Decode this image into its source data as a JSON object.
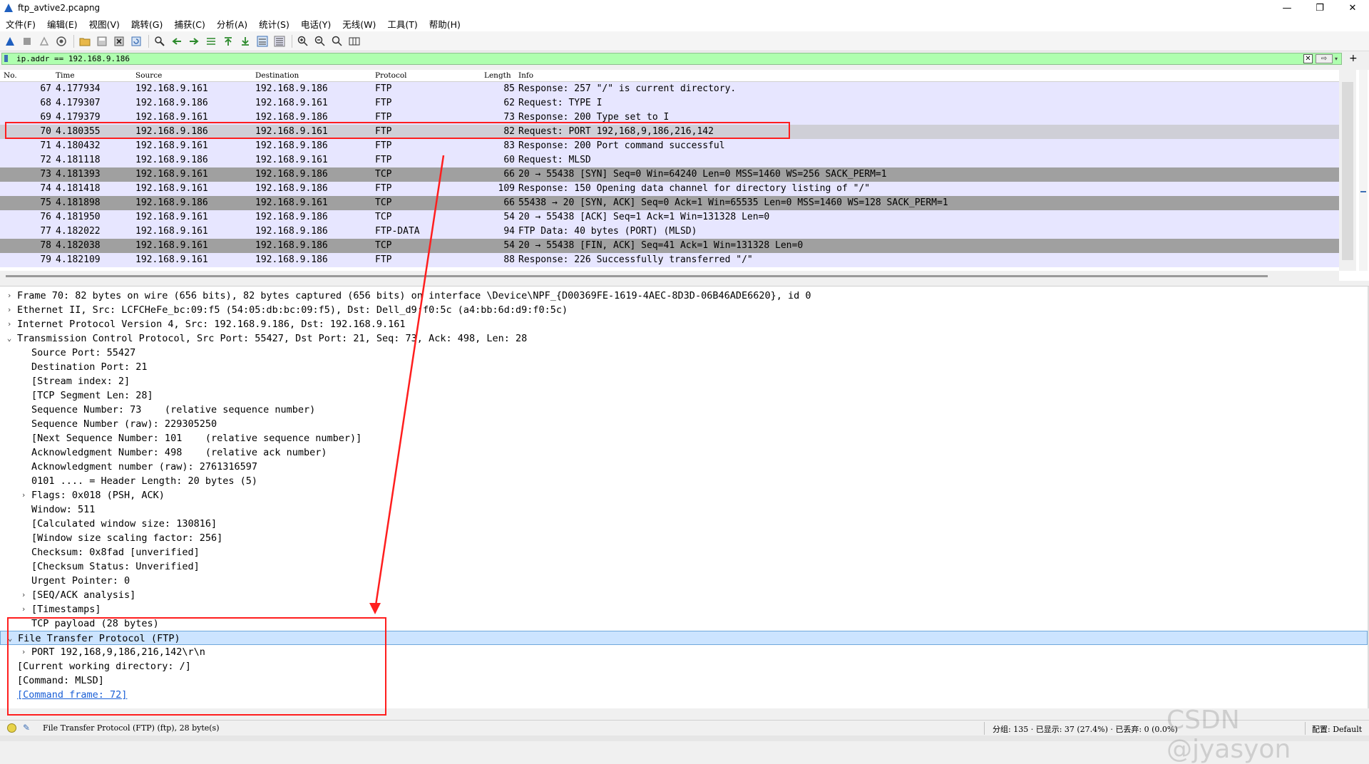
{
  "window": {
    "title": "ftp_avtive2.pcapng",
    "minimize": "—",
    "maximize": "❐",
    "close": "✕"
  },
  "menu": [
    "文件(F)",
    "编辑(E)",
    "视图(V)",
    "跳转(G)",
    "捕获(C)",
    "分析(A)",
    "统计(S)",
    "电话(Y)",
    "无线(W)",
    "工具(T)",
    "帮助(H)"
  ],
  "filter": {
    "value": "ip.addr == 192.168.9.186",
    "apply_icon": "⇨",
    "add_icon": "+"
  },
  "columns": {
    "no": "No.",
    "time": "Time",
    "source": "Source",
    "destination": "Destination",
    "protocol": "Protocol",
    "length": "Length",
    "info": "Info"
  },
  "colors": {
    "ftp_row": "#e7e6ff",
    "tcp_handshake_row": "#a0a0a0",
    "selected_row": "#cfcfd7",
    "filter_bg": "#afffaf",
    "annotation": "#ff1e1e",
    "link": "#1a5fd6"
  },
  "packets": [
    {
      "no": "67",
      "time": "4.177934",
      "src": "192.168.9.161",
      "dst": "192.168.9.186",
      "proto": "FTP",
      "len": "85",
      "info": "Response: 257 \"/\" is current directory.",
      "style": "ftp"
    },
    {
      "no": "68",
      "time": "4.179307",
      "src": "192.168.9.186",
      "dst": "192.168.9.161",
      "proto": "FTP",
      "len": "62",
      "info": "Request: TYPE I",
      "style": "ftp"
    },
    {
      "no": "69",
      "time": "4.179379",
      "src": "192.168.9.161",
      "dst": "192.168.9.186",
      "proto": "FTP",
      "len": "73",
      "info": "Response: 200 Type set to I",
      "style": "ftp"
    },
    {
      "no": "70",
      "time": "4.180355",
      "src": "192.168.9.186",
      "dst": "192.168.9.161",
      "proto": "FTP",
      "len": "82",
      "info": "Request: PORT 192,168,9,186,216,142",
      "style": "selected"
    },
    {
      "no": "71",
      "time": "4.180432",
      "src": "192.168.9.161",
      "dst": "192.168.9.186",
      "proto": "FTP",
      "len": "83",
      "info": "Response: 200 Port command successful",
      "style": "ftp"
    },
    {
      "no": "72",
      "time": "4.181118",
      "src": "192.168.9.186",
      "dst": "192.168.9.161",
      "proto": "FTP",
      "len": "60",
      "info": "Request: MLSD",
      "style": "ftp"
    },
    {
      "no": "73",
      "time": "4.181393",
      "src": "192.168.9.161",
      "dst": "192.168.9.186",
      "proto": "TCP",
      "len": "66",
      "info": "20 → 55438 [SYN] Seq=0 Win=64240 Len=0 MSS=1460 WS=256 SACK_PERM=1",
      "style": "tcp"
    },
    {
      "no": "74",
      "time": "4.181418",
      "src": "192.168.9.161",
      "dst": "192.168.9.186",
      "proto": "FTP",
      "len": "109",
      "info": "Response: 150 Opening data channel for directory listing of \"/\"",
      "style": "ftp"
    },
    {
      "no": "75",
      "time": "4.181898",
      "src": "192.168.9.186",
      "dst": "192.168.9.161",
      "proto": "TCP",
      "len": "66",
      "info": "55438 → 20 [SYN, ACK] Seq=0 Ack=1 Win=65535 Len=0 MSS=1460 WS=128 SACK_PERM=1",
      "style": "tcp"
    },
    {
      "no": "76",
      "time": "4.181950",
      "src": "192.168.9.161",
      "dst": "192.168.9.186",
      "proto": "TCP",
      "len": "54",
      "info": "20 → 55438 [ACK] Seq=1 Ack=1 Win=131328 Len=0",
      "style": "ftp"
    },
    {
      "no": "77",
      "time": "4.182022",
      "src": "192.168.9.161",
      "dst": "192.168.9.186",
      "proto": "FTP-DATA",
      "len": "94",
      "info": "FTP Data: 40 bytes (PORT) (MLSD)",
      "style": "ftp"
    },
    {
      "no": "78",
      "time": "4.182038",
      "src": "192.168.9.161",
      "dst": "192.168.9.186",
      "proto": "TCP",
      "len": "54",
      "info": "20 → 55438 [FIN, ACK] Seq=41 Ack=1 Win=131328 Len=0",
      "style": "tcp"
    },
    {
      "no": "79",
      "time": "4.182109",
      "src": "192.168.9.161",
      "dst": "192.168.9.186",
      "proto": "FTP",
      "len": "88",
      "info": "Response: 226 Successfully transferred \"/\"",
      "style": "ftp"
    }
  ],
  "details": [
    {
      "indent": 0,
      "arrow": "›",
      "text": "Frame 70: 82 bytes on wire (656 bits), 82 bytes captured (656 bits) on interface \\Device\\NPF_{D00369FE-1619-4AEC-8D3D-06B46ADE6620}, id 0"
    },
    {
      "indent": 0,
      "arrow": "›",
      "text": "Ethernet II, Src: LCFCHeFe_bc:09:f5 (54:05:db:bc:09:f5), Dst: Dell_d9:f0:5c (a4:bb:6d:d9:f0:5c)"
    },
    {
      "indent": 0,
      "arrow": "›",
      "text": "Internet Protocol Version 4, Src: 192.168.9.186, Dst: 192.168.9.161"
    },
    {
      "indent": 0,
      "arrow": "⌄",
      "text": "Transmission Control Protocol, Src Port: 55427, Dst Port: 21, Seq: 73, Ack: 498, Len: 28"
    },
    {
      "indent": 1,
      "arrow": "",
      "text": "Source Port: 55427"
    },
    {
      "indent": 1,
      "arrow": "",
      "text": "Destination Port: 21"
    },
    {
      "indent": 1,
      "arrow": "",
      "text": "[Stream index: 2]"
    },
    {
      "indent": 1,
      "arrow": "",
      "text": "[TCP Segment Len: 28]"
    },
    {
      "indent": 1,
      "arrow": "",
      "text": "Sequence Number: 73    (relative sequence number)"
    },
    {
      "indent": 1,
      "arrow": "",
      "text": "Sequence Number (raw): 229305250"
    },
    {
      "indent": 1,
      "arrow": "",
      "text": "[Next Sequence Number: 101    (relative sequence number)]"
    },
    {
      "indent": 1,
      "arrow": "",
      "text": "Acknowledgment Number: 498    (relative ack number)"
    },
    {
      "indent": 1,
      "arrow": "",
      "text": "Acknowledgment number (raw): 2761316597"
    },
    {
      "indent": 1,
      "arrow": "",
      "text": "0101 .... = Header Length: 20 bytes (5)"
    },
    {
      "indent": 1,
      "arrow": "›",
      "text": "Flags: 0x018 (PSH, ACK)"
    },
    {
      "indent": 1,
      "arrow": "",
      "text": "Window: 511"
    },
    {
      "indent": 1,
      "arrow": "",
      "text": "[Calculated window size: 130816]"
    },
    {
      "indent": 1,
      "arrow": "",
      "text": "[Window size scaling factor: 256]"
    },
    {
      "indent": 1,
      "arrow": "",
      "text": "Checksum: 0x8fad [unverified]"
    },
    {
      "indent": 1,
      "arrow": "",
      "text": "[Checksum Status: Unverified]"
    },
    {
      "indent": 1,
      "arrow": "",
      "text": "Urgent Pointer: 0"
    },
    {
      "indent": 1,
      "arrow": "›",
      "text": "[SEQ/ACK analysis]"
    },
    {
      "indent": 1,
      "arrow": "›",
      "text": "[Timestamps]"
    },
    {
      "indent": 1,
      "arrow": "",
      "text": "TCP payload (28 bytes)"
    },
    {
      "indent": 0,
      "arrow": "⌄",
      "text": "File Transfer Protocol (FTP)",
      "selected": true
    },
    {
      "indent": 1,
      "arrow": "›",
      "text": "PORT 192,168,9,186,216,142\\r\\n"
    },
    {
      "indent": 0,
      "arrow": "",
      "text": "[Current working directory: /]"
    },
    {
      "indent": 0,
      "arrow": "",
      "text": "[Command: MLSD]"
    },
    {
      "indent": 0,
      "arrow": "",
      "text": "[Command frame: 72]",
      "link": true
    }
  ],
  "status": {
    "protocol_text": "File Transfer Protocol (FTP) (ftp), 28 byte(s)",
    "stats": "分组: 135 · 已显示: 37 (27.4%) · 已丢弃: 0 (0.0%)",
    "profile": "配置: Default"
  },
  "watermark": "CSDN @jyasyon"
}
